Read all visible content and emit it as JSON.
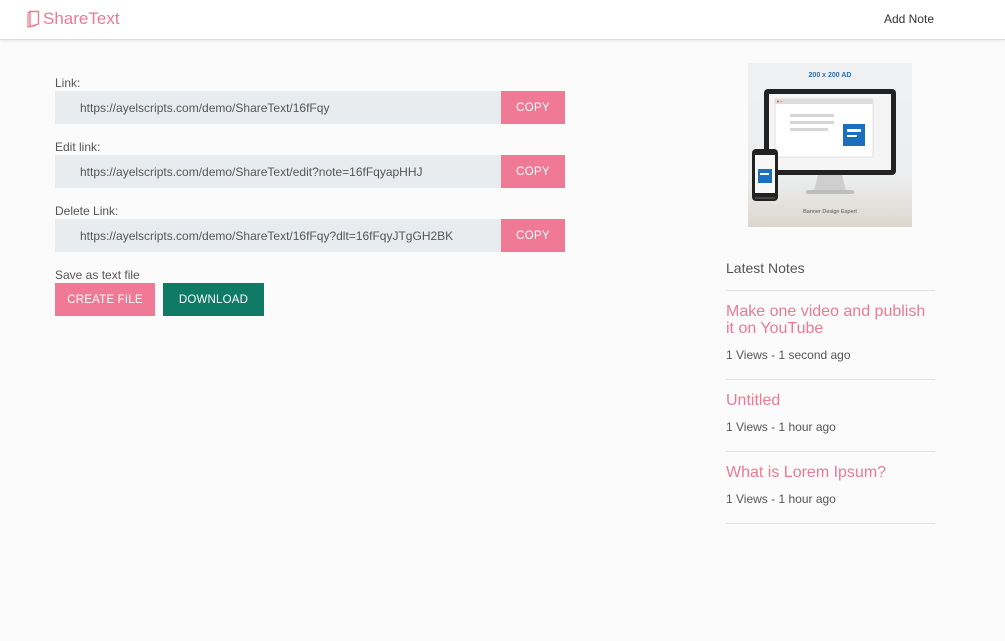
{
  "brand": {
    "name": "ShareText",
    "accent_color": "#ec7a93"
  },
  "nav": {
    "add_note": "Add Note"
  },
  "links": [
    {
      "label": "Link:",
      "value": "https://ayelscripts.com/demo/ShareText/16fFqy",
      "copy": "COPY"
    },
    {
      "label": "Edit link:",
      "value": "https://ayelscripts.com/demo/ShareText/edit?note=16fFqyapHHJ",
      "copy": "COPY"
    },
    {
      "label": "Delete Link:",
      "value": "https://ayelscripts.com/demo/ShareText/16fFqy?dlt=16fFqyJTgGH2BK",
      "copy": "COPY"
    }
  ],
  "save": {
    "label": "Save as text file",
    "create_button": "CREATE FILE",
    "download_button": "DOWNLOAD",
    "create_color": "#f07a95",
    "download_color": "#0f7a66"
  },
  "ad": {
    "title": "200 x 200 AD",
    "footer": "Banner Design Expert"
  },
  "sidebar": {
    "title": "Latest Notes",
    "notes": [
      {
        "title": "Make one video and publish it on YouTube",
        "meta": "1 Views - 1 second ago"
      },
      {
        "title": "Untitled",
        "meta": "1 Views - 1 hour ago"
      },
      {
        "title": "What is Lorem Ipsum?",
        "meta": "1 Views - 1 hour ago"
      }
    ]
  }
}
